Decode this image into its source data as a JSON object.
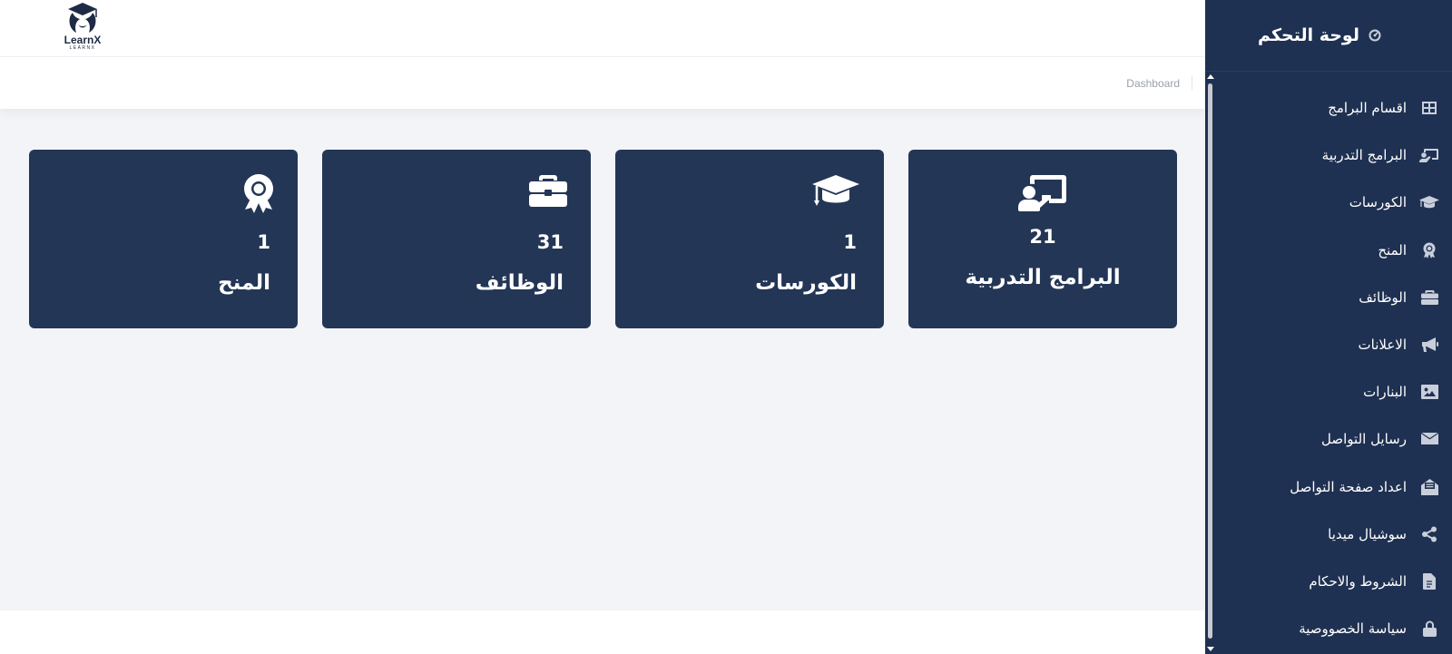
{
  "logo": {
    "title": "LearnX",
    "subtitle": "LEARNX"
  },
  "breadcrumb": {
    "current": "Dashboard"
  },
  "sidebar": {
    "title": "لوحة التحكم",
    "title_icon": "dashboard-gauge-icon",
    "items": [
      {
        "label": "اقسام البرامج",
        "icon": "grid-icon"
      },
      {
        "label": "البرامج التدربية",
        "icon": "chalkboard-teacher-icon"
      },
      {
        "label": "الكورسات",
        "icon": "graduation-cap-icon"
      },
      {
        "label": "المنح",
        "icon": "award-icon"
      },
      {
        "label": "الوظائف",
        "icon": "briefcase-icon"
      },
      {
        "label": "الاعلانات",
        "icon": "megaphone-icon"
      },
      {
        "label": "البنارات",
        "icon": "image-icon"
      },
      {
        "label": "رسايل التواصل",
        "icon": "envelope-icon"
      },
      {
        "label": "اعداد صفحة التواصل",
        "icon": "envelope-open-icon"
      },
      {
        "label": "سوشيال ميديا",
        "icon": "share-icon"
      },
      {
        "label": "الشروط والاحكام",
        "icon": "document-icon"
      },
      {
        "label": "سياسة الخصووصية",
        "icon": "lock-icon"
      }
    ]
  },
  "cards": [
    {
      "label": "البرامج التدربية",
      "value": "21",
      "icon": "chalkboard-teacher-icon"
    },
    {
      "label": "الكورسات",
      "value": "1",
      "icon": "graduation-cap-icon"
    },
    {
      "label": "الوظائف",
      "value": "31",
      "icon": "briefcase-icon"
    },
    {
      "label": "المنح",
      "value": "1",
      "icon": "award-icon"
    }
  ],
  "colors": {
    "sidebar_bg": "#1f3152",
    "card_bg": "#233656",
    "content_bg": "#f3f4f7"
  }
}
